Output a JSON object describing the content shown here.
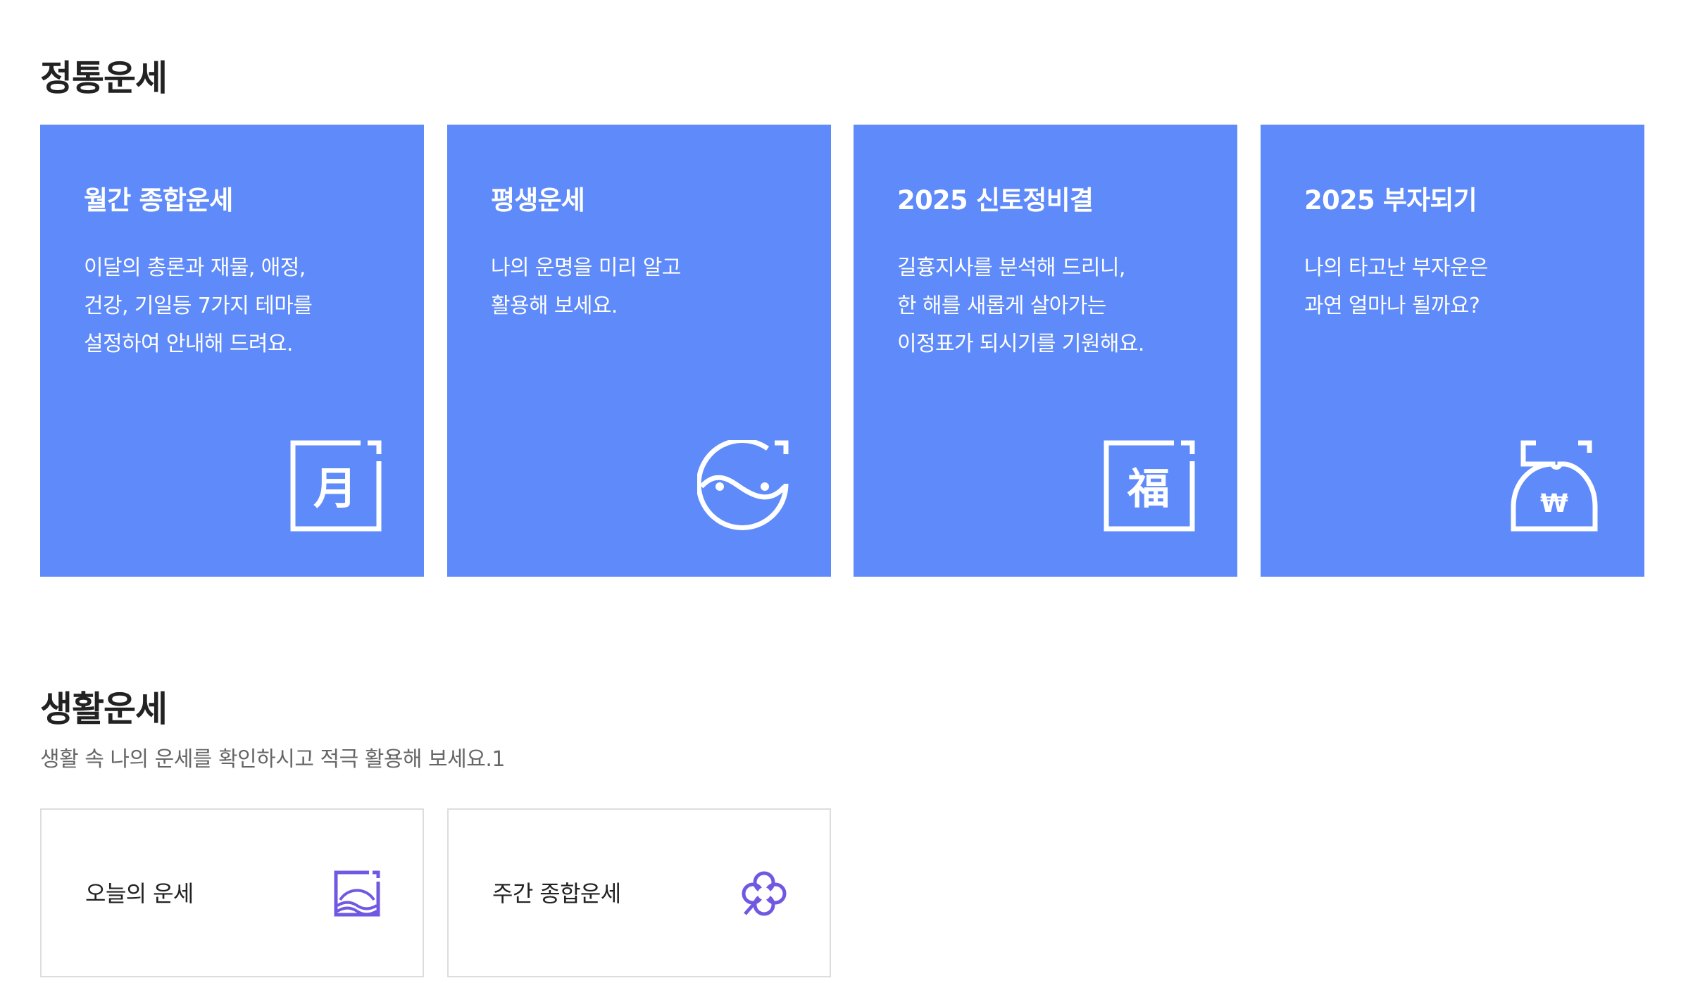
{
  "sections": {
    "traditional": {
      "title": "정통운세",
      "cards": [
        {
          "title": "월간 종합운세",
          "desc": [
            "이달의 총론과 재물, 애정,",
            "건강, 기일등 7가지 테마를",
            "설정하여 안내해 드려요."
          ],
          "icon": "moon-character-icon"
        },
        {
          "title": "평생운세",
          "desc": [
            "나의 운명을 미리 알고",
            "활용해 보세요."
          ],
          "icon": "yin-yang-icon"
        },
        {
          "title": "2025 신토정비결",
          "desc": [
            "길흉지사를 분석해 드리니,",
            "한 해를 새롭게 살아가는",
            "이정표가 되시기를 기원해요."
          ],
          "icon": "fortune-character-icon"
        },
        {
          "title": "2025 부자되기",
          "desc": [
            "나의 타고난 부자운은",
            "과연 얼마나 될까요?"
          ],
          "icon": "money-pouch-icon"
        }
      ]
    },
    "life": {
      "title": "생활운세",
      "desc": "생활 속 나의 운세를 확인하시고 적극 활용해 보세요.1",
      "cards": [
        {
          "label": "오늘의 운세",
          "icon": "sunrise-icon"
        },
        {
          "label": "주간 종합운세",
          "icon": "clover-icon"
        }
      ]
    }
  },
  "glyphs": {
    "moon": "月",
    "fortune": "福",
    "won": "₩"
  },
  "colors": {
    "card_blue": "#5e8afa",
    "icon_purple": "#7158e2",
    "title_text": "#222222",
    "desc_text": "#666666",
    "border": "#dddddd"
  }
}
